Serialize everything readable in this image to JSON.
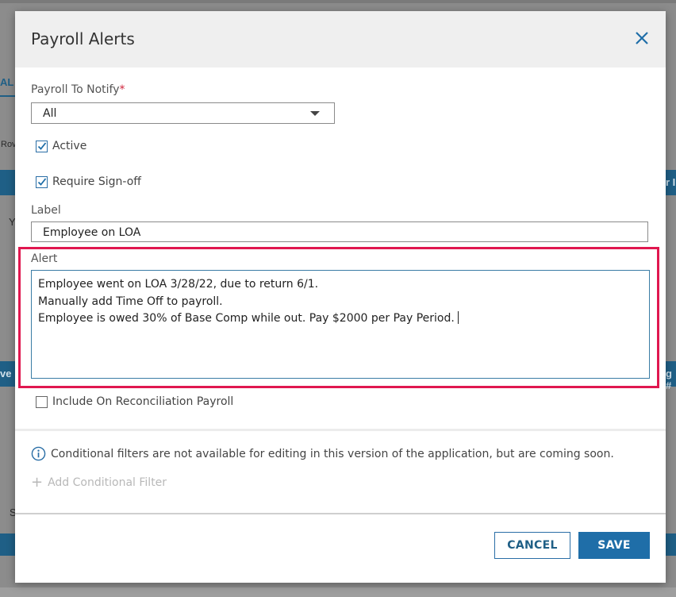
{
  "background": {
    "tab_label": "AL",
    "rows_text": "Rov",
    "letter_y": "Y",
    "letter_s": "S",
    "header_right": "r I",
    "header_left": "ve F",
    "header_right2": "g #"
  },
  "modal": {
    "title": "Payroll Alerts",
    "close_icon": "close-icon"
  },
  "form": {
    "payroll_to_notify_label": "Payroll To Notify",
    "required_marker": "*",
    "payroll_to_notify_value": "All",
    "active_label": "Active",
    "active_checked": true,
    "require_signoff_label": "Require Sign-off",
    "require_signoff_checked": true,
    "label_label": "Label",
    "label_value": "Employee on LOA",
    "alert_label": "Alert",
    "alert_lines": [
      "Employee went on LOA 3/28/22, due to return 6/1.",
      "Manually add Time Off to payroll.",
      "Employee is owed 30% of Base Comp while out. Pay $2000 per Pay Period."
    ],
    "include_reconciliation_label": "Include On Reconciliation Payroll",
    "include_reconciliation_checked": false
  },
  "conditional": {
    "info_text": "Conditional filters are not available for editing in this version of the application, but are coming soon.",
    "add_filter_label": "Add Conditional Filter"
  },
  "footer": {
    "cancel_label": "CANCEL",
    "save_label": "SAVE"
  },
  "colors": {
    "accent": "#1f6ea8",
    "highlight": "#e0174f",
    "required": "#d0253c"
  }
}
